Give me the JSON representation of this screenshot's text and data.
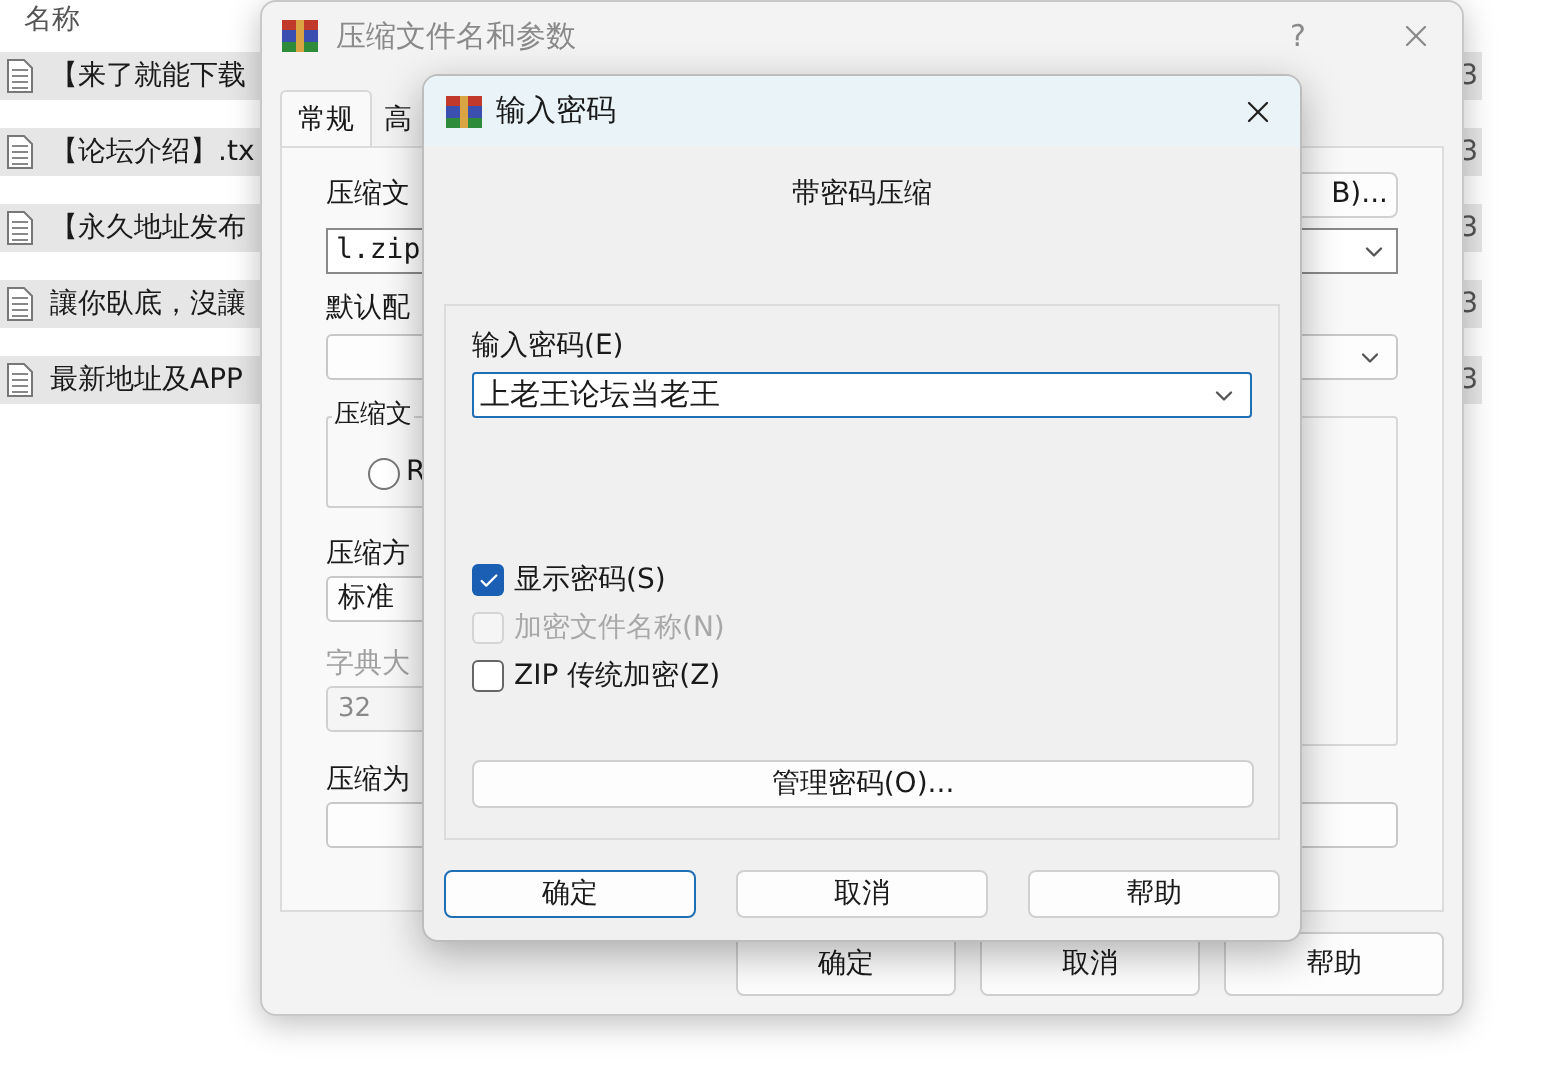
{
  "file_list": {
    "header": "名称",
    "rows": [
      {
        "name": "【来了就能下载",
        "column_2": "3"
      },
      {
        "name": "【论坛介绍】.tx",
        "column_2": "3"
      },
      {
        "name": "【永久地址发布",
        "column_2": "3"
      },
      {
        "name": "讓你臥底，沒讓",
        "column_2": "3"
      },
      {
        "name": "最新地址及APP",
        "column_2": "3"
      }
    ]
  },
  "main_dialog": {
    "title": "压缩文件名和参数",
    "help": "?",
    "tabs": [
      {
        "label": "常规",
        "selected": true
      },
      {
        "label": "高",
        "selected": false
      }
    ],
    "archive_name_label": "压缩文",
    "browse_button": "B)...",
    "archive_name": "l.zip",
    "profile_label": "默认配",
    "format_group": "压缩文",
    "format_option": {
      "label": "R",
      "selected": false
    },
    "method_label": "压缩方",
    "method": "标准",
    "dictionary_label": "字典大",
    "dictionary": "32",
    "dictionary_disabled": true,
    "split_label": "压缩为",
    "buttons": [
      "确定",
      "取消",
      "帮助"
    ]
  },
  "password_dialog": {
    "title": "输入密码",
    "heading": "带密码压缩",
    "password_label": "输入密码(E)",
    "password": "上老王论坛当老王",
    "options": [
      {
        "label": "显示密码(S)",
        "checked": true,
        "disabled": false
      },
      {
        "label": "加密文件名称(N)",
        "checked": false,
        "disabled": true
      },
      {
        "label": "ZIP 传统加密(Z)",
        "checked": false,
        "disabled": false
      }
    ],
    "manage_button": "管理密码(O)...",
    "buttons": [
      {
        "label": "确定",
        "default": true
      },
      {
        "label": "取消",
        "default": false
      },
      {
        "label": "帮助",
        "default": false
      }
    ]
  }
}
